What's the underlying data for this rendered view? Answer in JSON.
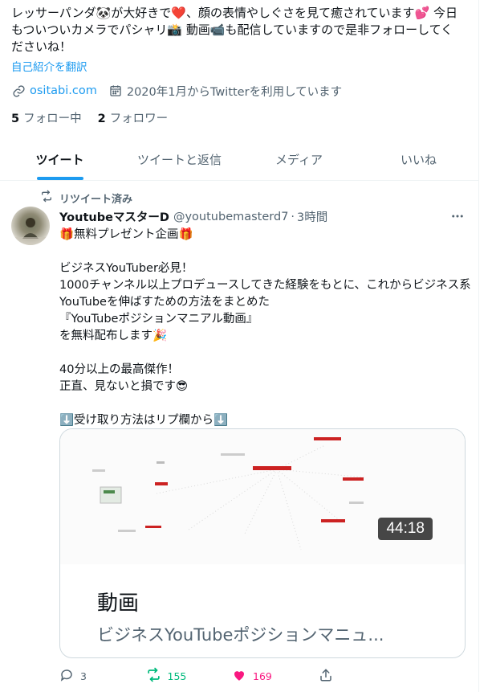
{
  "profile": {
    "bio_lines": [
      "レッサーパンダ🐼が大好きで❤️、顔の表情やしぐさを見て癒されています💕 今日",
      "もついついカメラでパシャリ📸 動画📹も配信していますので是非フォローしてく",
      "ださいね！"
    ],
    "translate_label": "自己紹介を翻訳",
    "website": "ositabi.com",
    "joined": "2020年1月からTwitterを利用しています",
    "following_count": "5",
    "following_label": "フォロー中",
    "followers_count": "2",
    "followers_label": "フォロワー"
  },
  "tabs": [
    {
      "label": "ツイート",
      "active": true
    },
    {
      "label": "ツイートと返信",
      "active": false
    },
    {
      "label": "メディア",
      "active": false
    },
    {
      "label": "いいね",
      "active": false
    }
  ],
  "tweet": {
    "retweet_label": "リツイート済み",
    "author_name": "YoutubeマスターD",
    "author_handle": "@youtubemasterd7",
    "separator": "·",
    "time": "3時間",
    "body": "🎁無料プレゼント企画🎁\n\nビジネスYouTuber必見！\n1000チャンネル以上プロデュースしてきた経験をもとに、これからビジネス系YouTubeを伸ばすための方法をまとめた\n『YouTubeポジションマニアル動画』\nを無料配布します🎉\n\n40分以上の最高傑作！\n正直、見ないと損です😎\n\n⬇️受け取り方法はリプ欄から⬇️",
    "card": {
      "duration": "44:18",
      "title": "動画",
      "description": "ビジネスYouTubeポジションマニュ..."
    },
    "actions": {
      "reply_count": "3",
      "retweet_count": "155",
      "like_count": "169"
    }
  },
  "colors": {
    "accent": "#1d9bf0",
    "retweet": "#00ba7c",
    "like": "#f91880",
    "secondary_text": "#536471"
  },
  "icons": [
    "link-icon",
    "calendar-icon",
    "retweet-icon",
    "more-icon",
    "reply-icon",
    "heart-icon",
    "share-icon"
  ]
}
